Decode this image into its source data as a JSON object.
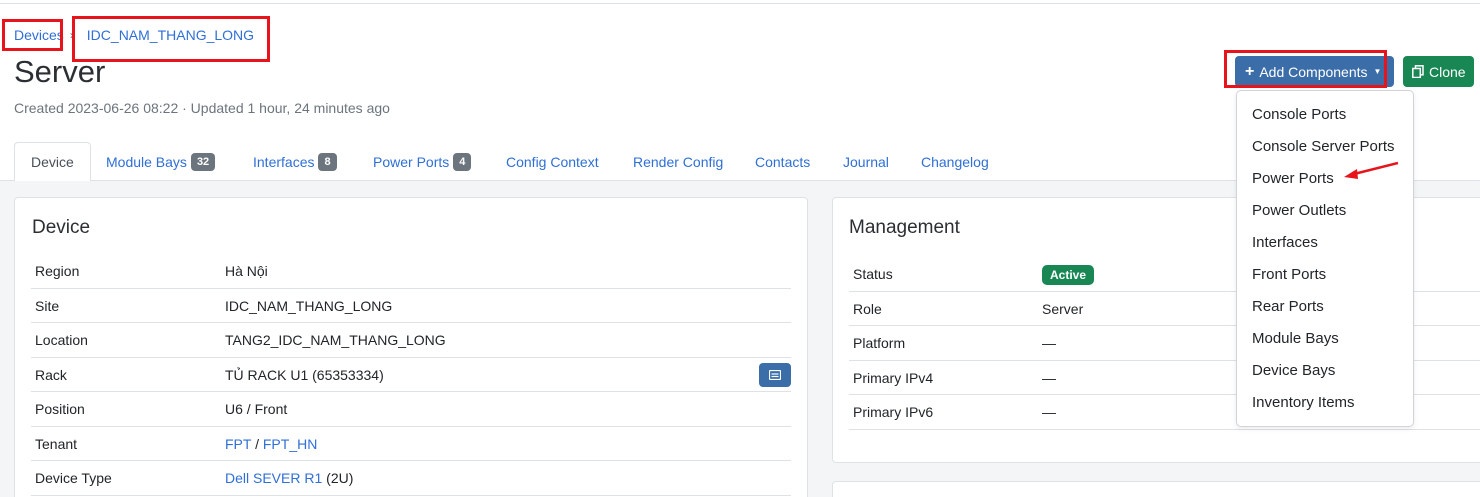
{
  "breadcrumb": {
    "root": "Devices",
    "site": "IDC_NAM_THANG_LONG"
  },
  "page": {
    "title": "Server",
    "meta": "Created 2023-06-26 08:22 · Updated 1 hour, 24 minutes ago"
  },
  "actions": {
    "add_components": "Add Components",
    "clone": "Clone"
  },
  "tabs": [
    {
      "label": "Device"
    },
    {
      "label": "Module Bays",
      "badge": "32"
    },
    {
      "label": "Interfaces",
      "badge": "8"
    },
    {
      "label": "Power Ports",
      "badge": "4"
    },
    {
      "label": "Config Context"
    },
    {
      "label": "Render Config"
    },
    {
      "label": "Contacts"
    },
    {
      "label": "Journal"
    },
    {
      "label": "Changelog"
    }
  ],
  "device_card": {
    "title": "Device",
    "rows": {
      "region": {
        "label": "Region",
        "value": "Hà Nội"
      },
      "site": {
        "label": "Site",
        "value": "IDC_NAM_THANG_LONG"
      },
      "location": {
        "label": "Location",
        "value": "TANG2_IDC_NAM_THANG_LONG"
      },
      "rack": {
        "label": "Rack",
        "value": "TỦ RACK U1 (65353334)"
      },
      "position": {
        "label": "Position",
        "value": "U6 / Front"
      },
      "tenant": {
        "label": "Tenant",
        "value_a": "FPT",
        "sep": " / ",
        "value_b": "FPT_HN"
      },
      "device_type": {
        "label": "Device Type",
        "value": "Dell SEVER R1",
        "suffix": " (2U)"
      }
    }
  },
  "management_card": {
    "title": "Management",
    "rows": {
      "status": {
        "label": "Status",
        "value": "Active"
      },
      "role": {
        "label": "Role",
        "value": "Server"
      },
      "platform": {
        "label": "Platform",
        "value": "—"
      },
      "ipv4": {
        "label": "Primary IPv4",
        "value": "—"
      },
      "ipv6": {
        "label": "Primary IPv6",
        "value": "—"
      }
    }
  },
  "dropdown": {
    "items": [
      "Console Ports",
      "Console Server Ports",
      "Power Ports",
      "Power Outlets",
      "Interfaces",
      "Front Ports",
      "Rear Ports",
      "Module Bays",
      "Device Bays",
      "Inventory Items"
    ]
  },
  "colors": {
    "link": "#2f6fd6",
    "primary": "#3b6ea8",
    "success": "#198754",
    "annotation": "#e8141b"
  }
}
